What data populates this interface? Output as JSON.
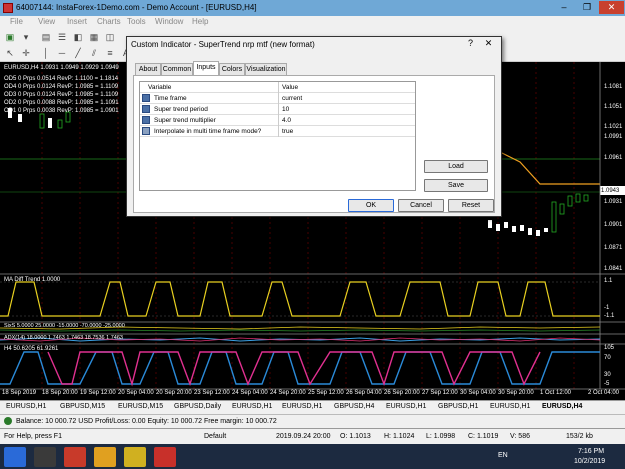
{
  "window": {
    "title": "64007144: InstaForex-1Demo.com - Demo Account - [EURUSD,H4]",
    "min_label": "–",
    "max_label": "❐",
    "close_label": "✕"
  },
  "menu": [
    "File",
    "View",
    "Insert",
    "Charts",
    "Tools",
    "Window",
    "Help"
  ],
  "chart": {
    "symbol_label": "EURUSD,H4  1.0931 1.0949 1.0929 1.0949",
    "orders": [
      "OD5 0  Prps  0.0514  RevP:  1.1100  = 1.1814",
      "OD4 0  Prps  0.0124  RevP:  1.0985  = 1.1109",
      "OD3 0  Prps  0.0124  RevP:  1.0985  = 1.1109",
      "OD2 0  Prps  0.0088  RevP:  1.0985  = 1.1091",
      "OD1 0  Prps  0.0038  RevP:  1.0985  = 1.0901"
    ],
    "price_labels": [
      "1.1081",
      "1.1051",
      "1.1021",
      "1.0991",
      "1.0961",
      "1.0943",
      "1.0931",
      "1.0901",
      "1.0871",
      "1.0841"
    ],
    "current_price": "1.0943",
    "ma_diff_label": "MA Diff Trend 1.0000",
    "ma_diff_axis": [
      "1.1",
      "-1",
      "-1.1"
    ],
    "sixs_label": "SixS 5.0000  25.0000  -15.0000  -70.0000  -25.0000",
    "adx_label": "ADX(14) 18.0000  1.7463  1.7463  18.7536  1.7463",
    "rsi_label": "H4 50.6205  61.9261",
    "rsi_axis": [
      "105",
      "70",
      "30",
      "-5"
    ],
    "time_labels": [
      "18 Sep 2019",
      "18 Sep 20:00",
      "19 Sep 12:00",
      "20 Sep 04:00",
      "20 Sep 20:00",
      "23 Sep 12:00",
      "24 Sep 04:00",
      "24 Sep 20:00",
      "25 Sep 12:00",
      "26 Sep 04:00",
      "26 Sep 20:00",
      "27 Sep 12:00",
      "30 Sep 04:00",
      "30 Sep 20:00",
      "1 Oct 12:00",
      "2 Oct 04:00"
    ]
  },
  "dialog": {
    "title": "Custom Indicator - SuperTrend nrp mtf (new format)",
    "help_label": "?",
    "close_label": "✕",
    "tabs": [
      "About",
      "Common",
      "Inputs",
      "Colors",
      "Visualization"
    ],
    "active_tab": "Inputs",
    "columns": [
      "Variable",
      "Value"
    ],
    "rows": [
      {
        "name": "Time frame",
        "value": "current"
      },
      {
        "name": "Super trend period",
        "value": "10"
      },
      {
        "name": "Super trend multiplier",
        "value": "4.0"
      },
      {
        "name": "Interpolate in multi time frame mode?",
        "value": "true"
      }
    ],
    "load_label": "Load",
    "save_label": "Save",
    "ok_label": "OK",
    "cancel_label": "Cancel",
    "reset_label": "Reset"
  },
  "tabs": [
    "EURUSD,H1",
    "GBPUSD,M15",
    "EURUSD,M15",
    "GBPUSD,Daily",
    "EURUSD,H1",
    "EURUSD,H1",
    "GBPUSD,H4",
    "EURUSD,H1",
    "GBPUSD,H1",
    "EURUSD,H1",
    "EURUSD,H4"
  ],
  "balance": "Balance: 10 000.72 USD   Profit/Loss: 0.00   Equity: 10 000.72   Free margin: 10 000.72",
  "status": {
    "help": "For Help, press F1",
    "profile": "Default",
    "datetime": "2019.09.24 20:00",
    "open": "O: 1.1013",
    "high": "H: 1.1024",
    "low": "L: 1.0998",
    "close": "C: 1.1019",
    "volume": "V: 586",
    "traffic": "153/2 kb"
  },
  "taskbar": {
    "lang": "EN",
    "time": "7:16 PM",
    "date": "10/2/2019"
  }
}
